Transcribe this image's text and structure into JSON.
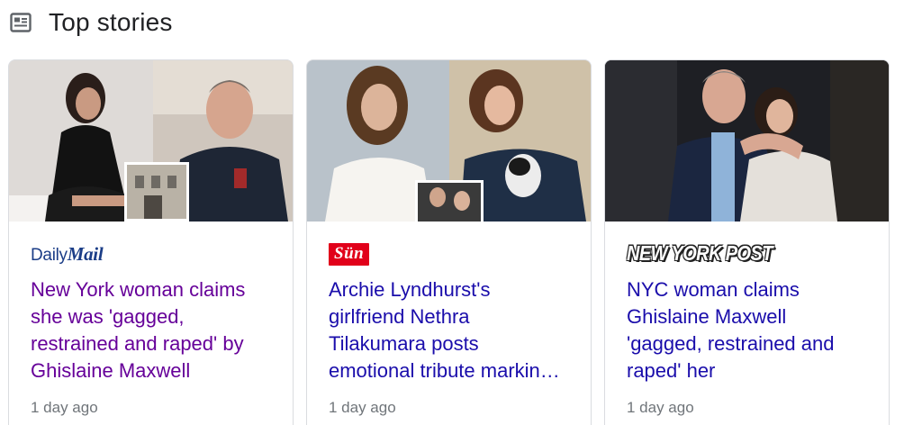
{
  "header": {
    "title": "Top stories",
    "icon": "newspaper-icon"
  },
  "stories": [
    {
      "source_prefix": "Daily",
      "source_suffix": "Mail",
      "headline": "New York woman claims she was 'gagged, restrained and raped' by Ghislaine Maxwell",
      "time": "1 day ago",
      "visited": true
    },
    {
      "source": "Sün",
      "headline": "Archie Lyndhurst's girlfriend Nethra Tilakumara posts emotional tribute marking what would have been his birthday",
      "time": "1 day ago",
      "visited": false
    },
    {
      "source": "NEW YORK POST",
      "headline": "NYC woman claims Ghislaine Maxwell 'gagged, restrained and raped' her",
      "time": "1 day ago",
      "visited": false
    }
  ],
  "colors": {
    "visited_link": "#660099",
    "link": "#1a0dab",
    "meta": "#70757a",
    "sun_red": "#e1001a",
    "dailymail_blue": "#1b3d87"
  }
}
